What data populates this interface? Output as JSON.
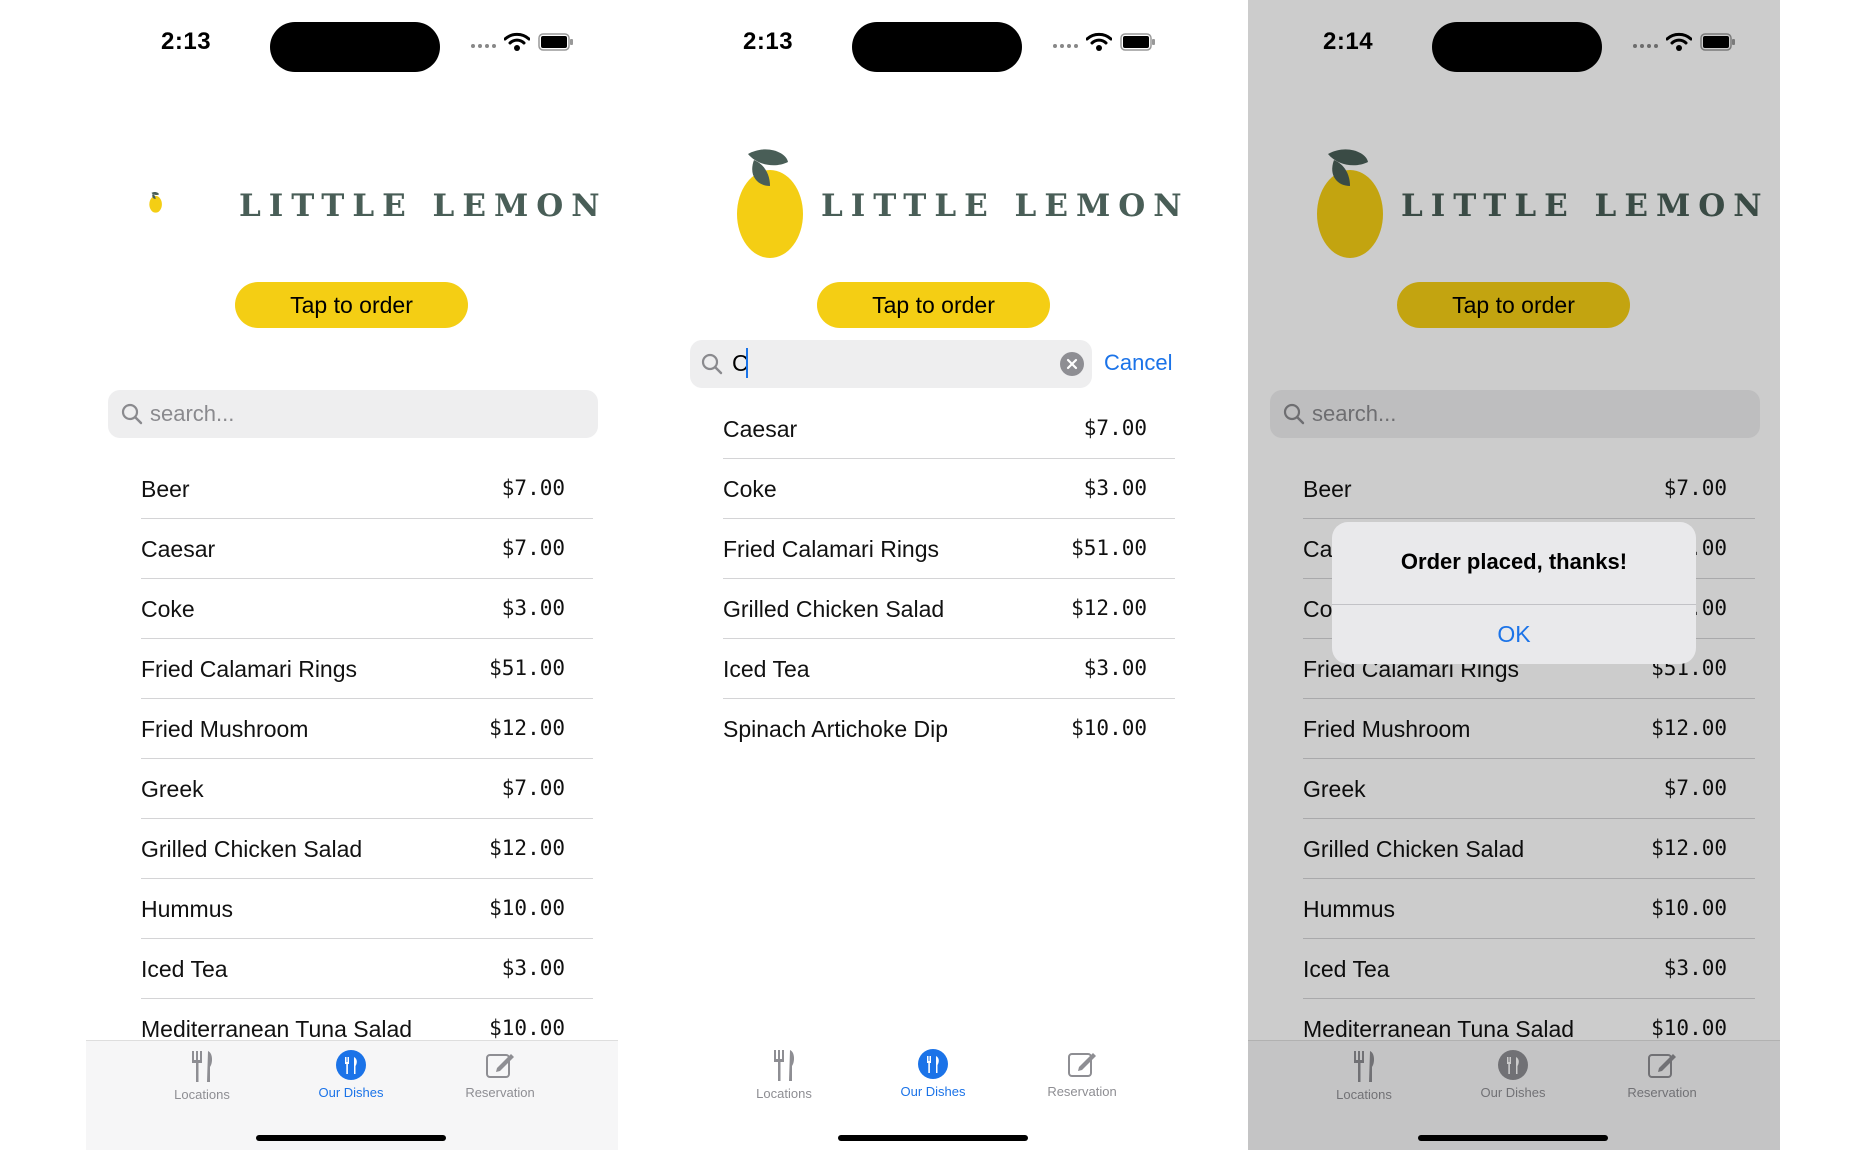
{
  "colors": {
    "lemon_yellow": "#f4ce14",
    "brand_green": "#495e57",
    "accent_blue": "#1b73e8",
    "tab_inactive": "#8e8e93"
  },
  "brand": {
    "logo_text": "LITTLE LEMON",
    "logo_icon": "lemon-icon"
  },
  "order_button": {
    "label": "Tap to order"
  },
  "tabs": [
    {
      "label": "Locations",
      "icon": "fork-knife-icon"
    },
    {
      "label": "Our Dishes",
      "icon": "dishes-icon"
    },
    {
      "label": "Reservation",
      "icon": "edit-icon"
    }
  ],
  "screens": [
    {
      "status_time": "2:13",
      "search": {
        "placeholder": "search..."
      },
      "active_tab": "Our Dishes",
      "menu": [
        {
          "name": "Beer",
          "price": "$7.00"
        },
        {
          "name": "Caesar",
          "price": "$7.00"
        },
        {
          "name": "Coke",
          "price": "$3.00"
        },
        {
          "name": "Fried Calamari Rings",
          "price": "$51.00"
        },
        {
          "name": "Fried Mushroom",
          "price": "$12.00"
        },
        {
          "name": "Greek",
          "price": "$7.00"
        },
        {
          "name": "Grilled Chicken Salad",
          "price": "$12.00"
        },
        {
          "name": "Hummus",
          "price": "$10.00"
        },
        {
          "name": "Iced Tea",
          "price": "$3.00"
        },
        {
          "name": "Mediterranean Tuna Salad",
          "price": "$10.00"
        }
      ]
    },
    {
      "status_time": "2:13",
      "search": {
        "value": "C",
        "cancel_label": "Cancel"
      },
      "active_tab": "Our Dishes",
      "menu": [
        {
          "name": "Caesar",
          "price": "$7.00"
        },
        {
          "name": "Coke",
          "price": "$3.00"
        },
        {
          "name": "Fried Calamari Rings",
          "price": "$51.00"
        },
        {
          "name": "Grilled Chicken Salad",
          "price": "$12.00"
        },
        {
          "name": "Iced Tea",
          "price": "$3.00"
        },
        {
          "name": "Spinach Artichoke Dip",
          "price": "$10.00"
        }
      ]
    },
    {
      "status_time": "2:14",
      "search": {
        "placeholder": "search..."
      },
      "alert": {
        "title": "Order placed, thanks!",
        "ok_label": "OK"
      },
      "menu": [
        {
          "name": "Beer",
          "price": "$7.00"
        },
        {
          "name": "Caesar",
          "price": "$7.00"
        },
        {
          "name": "Coke",
          "price": "$3.00"
        },
        {
          "name": "Fried Calamari Rings",
          "price": "$51.00"
        },
        {
          "name": "Fried Mushroom",
          "price": "$12.00"
        },
        {
          "name": "Greek",
          "price": "$7.00"
        },
        {
          "name": "Grilled Chicken Salad",
          "price": "$12.00"
        },
        {
          "name": "Hummus",
          "price": "$10.00"
        },
        {
          "name": "Iced Tea",
          "price": "$3.00"
        },
        {
          "name": "Mediterranean Tuna Salad",
          "price": "$10.00"
        }
      ]
    }
  ]
}
